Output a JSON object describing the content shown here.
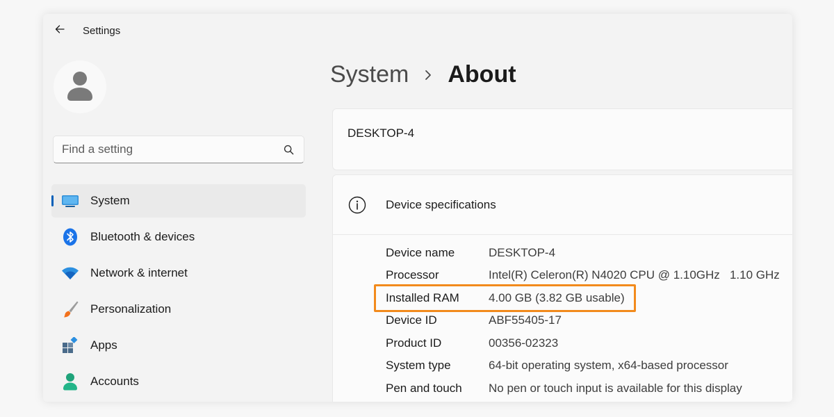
{
  "window": {
    "title": "Settings"
  },
  "search": {
    "placeholder": "Find a setting"
  },
  "sidebar": {
    "items": [
      {
        "label": "System",
        "icon": "monitor-icon",
        "active": true
      },
      {
        "label": "Bluetooth & devices",
        "icon": "bluetooth-icon"
      },
      {
        "label": "Network & internet",
        "icon": "wifi-icon"
      },
      {
        "label": "Personalization",
        "icon": "paintbrush-icon"
      },
      {
        "label": "Apps",
        "icon": "apps-icon"
      },
      {
        "label": "Accounts",
        "icon": "person-icon"
      }
    ]
  },
  "breadcrumb": {
    "parent": "System",
    "current": "About"
  },
  "device": {
    "name_heading": "DESKTOP-4"
  },
  "specs": {
    "title": "Device specifications",
    "rows": [
      {
        "label": "Device name",
        "value": "DESKTOP-4"
      },
      {
        "label": "Processor",
        "value": "Intel(R) Celeron(R) N4020 CPU @ 1.10GHz   1.10 GHz"
      },
      {
        "label": "Installed RAM",
        "value": "4.00 GB (3.82 GB usable)"
      },
      {
        "label": "Device ID",
        "value": "ABF55405-17"
      },
      {
        "label": "Product ID",
        "value": "00356-02323"
      },
      {
        "label": "System type",
        "value": "64-bit operating system, x64-based processor"
      },
      {
        "label": "Pen and touch",
        "value": "No pen or touch input is available for this display"
      }
    ]
  },
  "colors": {
    "accent": "#005fb8",
    "highlight": "#f28a1c"
  }
}
